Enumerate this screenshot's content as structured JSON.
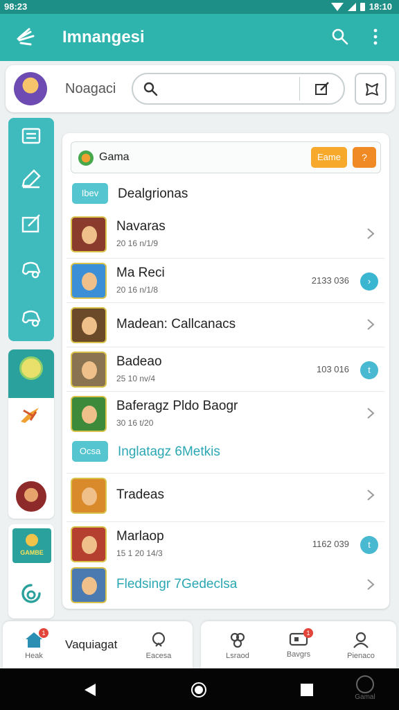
{
  "status_bar": {
    "time": "98:23",
    "right": "18:10"
  },
  "appbar": {
    "title": "Imnangesi"
  },
  "profile": {
    "name": "Noagaci"
  },
  "game_bar": {
    "label": "Gama",
    "button": "Eame",
    "button2": "?"
  },
  "sections": [
    {
      "tag": "Ibev",
      "title": "Dealgrionas"
    },
    {
      "tag": "Ocsa",
      "title": "Inglatagz 6Metkis"
    }
  ],
  "rows": [
    {
      "title": "Navaras",
      "subtitle": "20 16 n/1/9",
      "value": "",
      "action": "chevron"
    },
    {
      "title": "Ma Reci",
      "subtitle": "20 16 n/1/8",
      "value": "2133 036",
      "action": "circle"
    },
    {
      "title": "Madean: Callcanacs",
      "subtitle": "",
      "value": "",
      "action": "chevron"
    },
    {
      "title": "Badeao",
      "subtitle": "25 10 nv/4",
      "value": "103 016",
      "action": "circle"
    },
    {
      "title": "Baferagz Pldo Baogr",
      "subtitle": "30 16 t/20",
      "value": "",
      "action": "chevron"
    },
    {
      "title": "Tradeas",
      "subtitle": "",
      "value": "",
      "action": "chevron"
    },
    {
      "title": "Marlaop",
      "subtitle": "15 1 20 14/3",
      "value": "1162 039",
      "action": "circle"
    },
    {
      "title": "Fledsingr 7Gedeclsa",
      "subtitle": "",
      "value": "",
      "action": "chevron"
    }
  ],
  "rail": {
    "game_badge": "GAMBE",
    "watermark": "Gamal"
  },
  "bottom_nav": {
    "left_title": "Vaquiagat",
    "items": [
      {
        "label": "Heak",
        "badge": "1",
        "icon": "home-icon"
      },
      {
        "label": "Eacesa",
        "badge": "",
        "icon": "search-icon"
      },
      {
        "label": "Lsraod",
        "badge": "",
        "icon": "group-icon"
      },
      {
        "label": "Bavgrs",
        "badge": "1",
        "icon": "game-icon"
      },
      {
        "label": "Pienaco",
        "badge": "",
        "icon": "profile-icon"
      }
    ]
  },
  "colors": {
    "accent": "#2fb3ad",
    "rail": "#40bbbd",
    "orange": "#f6a92b",
    "link": "#2aa7b3"
  }
}
